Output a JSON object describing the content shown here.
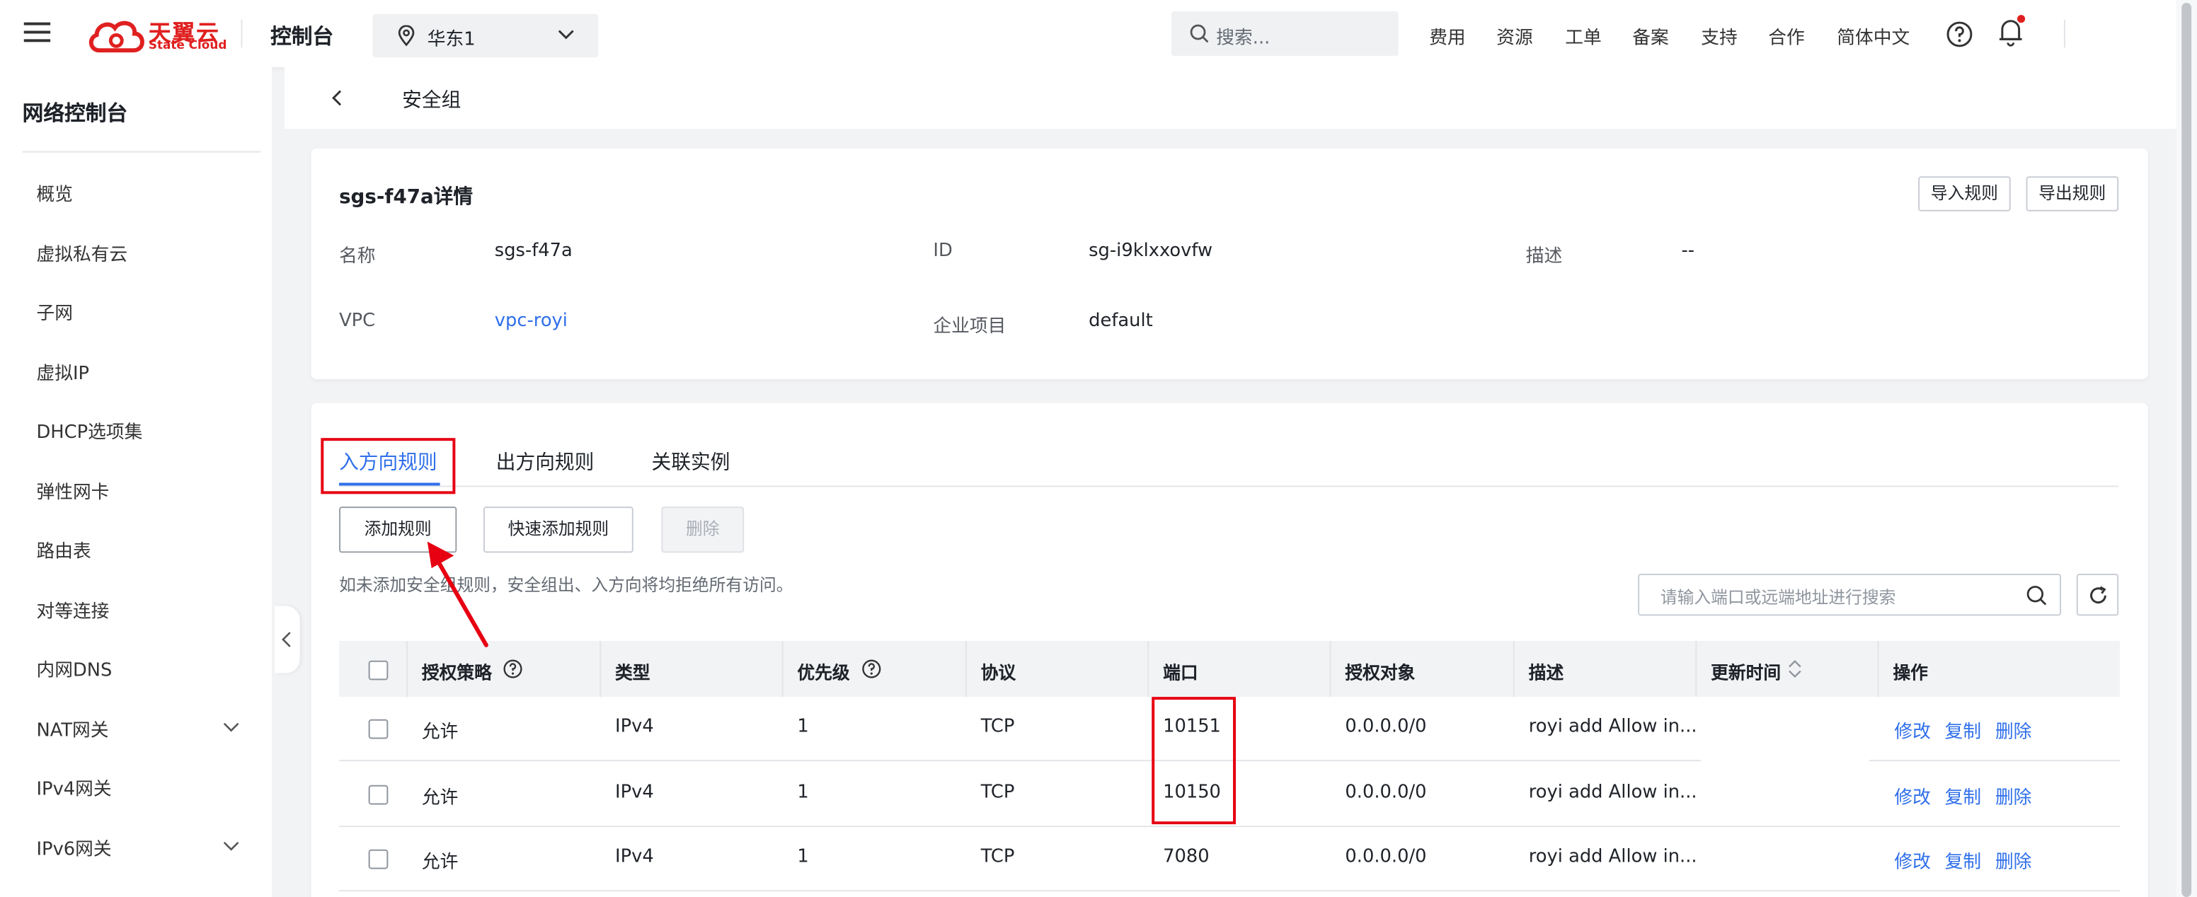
{
  "header": {
    "logo_cn": "天翼云",
    "logo_en": "State Cloud",
    "console": "控制台",
    "region": "华东1",
    "search_placeholder": "搜索...",
    "nav": [
      "费用",
      "资源",
      "工单",
      "备案",
      "支持",
      "合作",
      "简体中文"
    ]
  },
  "sidebar": {
    "title": "网络控制台",
    "items": [
      "概览",
      "虚拟私有云",
      "子网",
      "虚拟IP",
      "DHCP选项集",
      "弹性网卡",
      "路由表",
      "对等连接",
      "内网DNS",
      "NAT网关",
      "IPv4网关",
      "IPv6网关"
    ]
  },
  "page": {
    "title": "安全组"
  },
  "detail": {
    "heading": "sgs-f47a详情",
    "import_btn": "导入规则",
    "export_btn": "导出规则",
    "name_label": "名称",
    "name_value": "sgs-f47a",
    "id_label": "ID",
    "id_value": "sg-i9klxxovfw",
    "desc_label": "描述",
    "desc_value": "--",
    "vpc_label": "VPC",
    "vpc_value": "vpc-royi",
    "project_label": "企业项目",
    "project_value": "default"
  },
  "tabs": [
    "入方向规则",
    "出方向规则",
    "关联实例"
  ],
  "toolbar": {
    "add": "添加规则",
    "quick_add": "快速添加规则",
    "delete": "删除",
    "hint": "如未添加安全组规则，安全组出、入方向将均拒绝所有访问。",
    "search_placeholder": "请输入端口或远端地址进行搜索"
  },
  "table": {
    "headers": [
      "授权策略",
      "类型",
      "优先级",
      "协议",
      "端口",
      "授权对象",
      "描述",
      "更新时间",
      "操作"
    ],
    "rows": [
      {
        "policy": "允许",
        "type": "IPv4",
        "priority": "1",
        "protocol": "TCP",
        "port": "10151",
        "target": "0.0.0.0/0",
        "desc": "royi add Allow in..."
      },
      {
        "policy": "允许",
        "type": "IPv4",
        "priority": "1",
        "protocol": "TCP",
        "port": "10150",
        "target": "0.0.0.0/0",
        "desc": "royi add Allow in..."
      },
      {
        "policy": "允许",
        "type": "IPv4",
        "priority": "1",
        "protocol": "TCP",
        "port": "7080",
        "target": "0.0.0.0/0",
        "desc": "royi add Allow in..."
      }
    ],
    "ops": [
      "修改",
      "复制",
      "删除"
    ]
  },
  "colors": {
    "accent": "#2f6fea",
    "annotation_red": "#e60012",
    "brand_red": "#e02020"
  }
}
